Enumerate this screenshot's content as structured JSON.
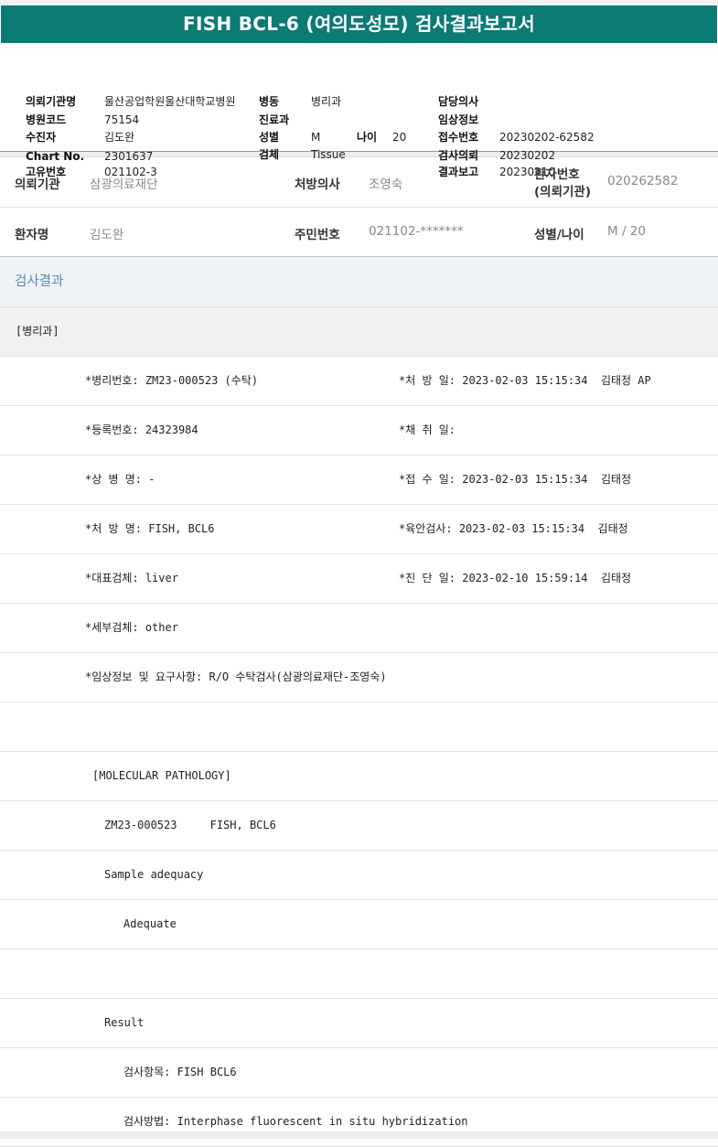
{
  "title": "FISH BCL-6 (여의도성모) 검사결과보고서",
  "header": {
    "institution_label": "의뢰기관명",
    "institution_value": "울산공업학원울산대학교병원",
    "hospital_code_label": "병원코드",
    "hospital_code_value": "75154",
    "examinee_label": "수진자",
    "examinee_value": "김도완",
    "chart_label": "Chart No.",
    "chart_value": "2301637",
    "unique_label": "고유번호",
    "unique_value": "021102-3",
    "ward_label": "병동",
    "ward_value": "병리과",
    "dept_label": "진료과",
    "dept_value": "",
    "sex_label": "성별",
    "sex_value": "M",
    "age_label": "나이",
    "age_value": "20",
    "specimen_label": "검체",
    "specimen_value": "Tissue",
    "doctor_label": "담당의사",
    "doctor_value": "",
    "clinical_label": "임상정보",
    "clinical_value": "",
    "receipt_label": "접수번호",
    "receipt_value": "20230202-62582",
    "request_label": "검사의뢰",
    "request_value": "20230202",
    "report_label": "결과보고",
    "report_value": "20230210"
  },
  "info": {
    "org_label": "의뢰기관",
    "org_value": "삼광의료재단",
    "prescriber_label": "처방의사",
    "prescriber_value": "조영숙",
    "patient_no_label_1": "환자번호",
    "patient_no_label_2": "(의뢰기관)",
    "patient_no_value": "020262582",
    "patient_name_label": "환자명",
    "patient_name_value": "김도완",
    "resident_label": "주민번호",
    "resident_value": "021102-*******",
    "sex_age_label": "성별/나이",
    "sex_age_value": "M / 20"
  },
  "results_title": "검사결과",
  "dept_header": "[병리과]",
  "fields": [
    {
      "left": "*병리번호: ZM23-000523 (수탁)",
      "right": "*처 방 일: 2023-02-03 15:15:34  김태정 AP"
    },
    {
      "left": "*등록번호: 24323984",
      "right": "*채 취 일:"
    },
    {
      "left": "*상 병 명: -",
      "right": "*접 수 일: 2023-02-03 15:15:34  김태정"
    },
    {
      "left": "*처 방 명: FISH, BCL6",
      "right": "*육안검사: 2023-02-03 15:15:34  김태정"
    },
    {
      "left": "*대표검체: liver",
      "right": "*진 단 일: 2023-02-10 15:59:14  김태정"
    },
    {
      "left": "*세부검체: other",
      "right": ""
    },
    {
      "left": "*임상정보 및 요구사항: R/O 수탁검사(삼광의료재단-조영숙)",
      "right": ""
    }
  ],
  "report_lines": [
    {
      "text": "",
      "indent": 0
    },
    {
      "text": "[MOLECULAR PATHOLOGY]",
      "indent": 101
    },
    {
      "text": "ZM23-000523     FISH, BCL6",
      "indent": 114
    },
    {
      "text": "Sample adequacy",
      "indent": 114
    },
    {
      "text": "Adequate",
      "indent": 135
    },
    {
      "text": "",
      "indent": 0
    },
    {
      "text": "Result",
      "indent": 114
    },
    {
      "text": "검사항목: FISH BCL6",
      "indent": 135
    },
    {
      "text": "검사방법: Interphase fluorescent in situ hybridization",
      "indent": 135
    }
  ]
}
